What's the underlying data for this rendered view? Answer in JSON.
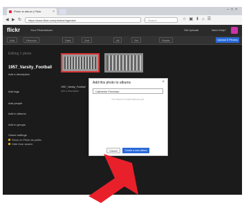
{
  "browser": {
    "tab_title": "Photo to album | Flickr",
    "url": "https://www.flickr.com/photos/organize/",
    "search_placeholder": "Search"
  },
  "flickr": {
    "logo": "flickr",
    "nav_photostream": "Your Photostream",
    "nav_upload": "Old Uploadr",
    "nav_help": "Need Help?"
  },
  "toolbar": {
    "buttons": [
      "Add",
      "Remove",
      "Date",
      "Sort",
      "All",
      "Set",
      "Rotate"
    ],
    "publish_label": "Upload 3 Photos"
  },
  "sidebar": {
    "heading": "Editing 1 photo",
    "title": "1957_Varsity_Football",
    "add_description": "Add a description",
    "add_tags": "Add tags",
    "add_people": "Add people",
    "add_to_albums": "Add to albums",
    "add_to_groups": "Add to groups",
    "owner_settings": "Owner settings",
    "setting_1": "Show on Flickr as public",
    "setting_2": "Hide from search"
  },
  "photo": {
    "title": "1957_Varsity_Football",
    "subtitle": "Add a description"
  },
  "modal": {
    "title": "Add this photo to albums",
    "input_value": "Catherine Freeman",
    "message": "You haven't created albums yet.",
    "cancel_label": "Cancel",
    "create_label": "Create a new album"
  },
  "colors": {
    "accent": "#2a6ad8",
    "arrow": "#e8202a",
    "dark_bg": "#1b1b1b"
  }
}
